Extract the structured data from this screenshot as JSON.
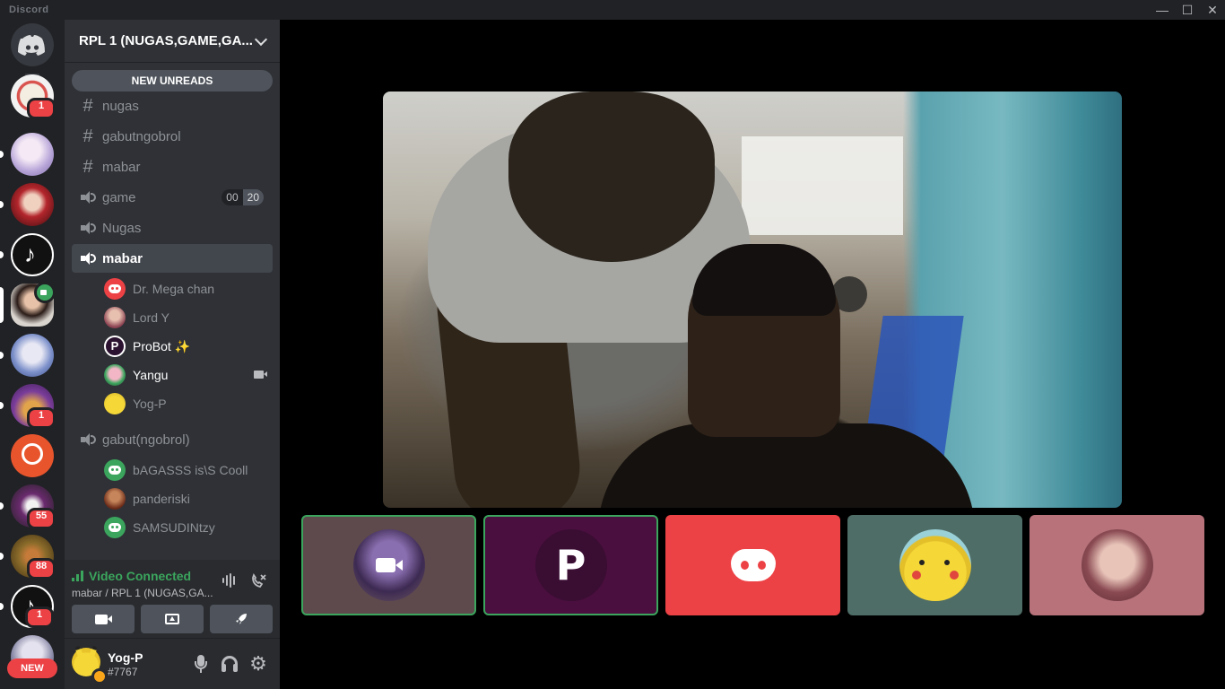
{
  "window": {
    "title": "Discord",
    "controls": [
      "minimize",
      "maximize",
      "close"
    ]
  },
  "guilds": {
    "home_icon": "discord-logo-icon",
    "items": [
      {
        "name": "server-1",
        "badge": "1",
        "color": "#d9534f"
      },
      {
        "name": "server-2",
        "badge": "",
        "color": "#b8a6d9"
      },
      {
        "name": "server-3",
        "badge": "",
        "color": "#b3262c"
      },
      {
        "name": "server-4",
        "badge": "",
        "color": "#111111"
      },
      {
        "name": "server-rpl1",
        "badge": "",
        "color": "#5a3a30",
        "active": true,
        "video": true
      },
      {
        "name": "server-6",
        "badge": "",
        "color": "#7b8fc9"
      },
      {
        "name": "server-7",
        "badge": "1",
        "color": "#7a3d9a"
      },
      {
        "name": "server-8",
        "badge": "",
        "color": "#e8552d"
      },
      {
        "name": "server-9",
        "badge": "55",
        "color": "#6a2a6e"
      },
      {
        "name": "server-10",
        "badge": "88",
        "color": "#8a6b2a"
      },
      {
        "name": "server-11",
        "badge": "1",
        "color": "#111111"
      },
      {
        "name": "server-12",
        "badge": "",
        "color": "#8a8aa8"
      }
    ],
    "new_label": "NEW"
  },
  "server": {
    "name": "RPL 1 (NUGAS,GAME,GA...",
    "new_unreads_label": "NEW UNREADS"
  },
  "channels": [
    {
      "type": "text",
      "name": "nugas"
    },
    {
      "type": "text",
      "name": "gabutngobrol"
    },
    {
      "type": "text",
      "name": "mabar"
    },
    {
      "type": "voice",
      "name": "game",
      "count_left": "00",
      "count_right": "20"
    },
    {
      "type": "voice",
      "name": "Nugas"
    },
    {
      "type": "voice",
      "name": "mabar",
      "active": true,
      "members": [
        {
          "name": "Dr. Mega chan",
          "avatar": "discord-red"
        },
        {
          "name": "Lord Y",
          "avatar": "pink"
        },
        {
          "name": "ProBot ✨",
          "avatar": "probot",
          "bright": true
        },
        {
          "name": "Yangu",
          "avatar": "yangu",
          "bright": true,
          "video": true
        },
        {
          "name": "Yog-P",
          "avatar": "pikachu"
        }
      ]
    },
    {
      "type": "voice",
      "name": "gabut(ngobrol)",
      "members": [
        {
          "name": "bAGASSS is\\S Cooll",
          "avatar": "discord-green"
        },
        {
          "name": "panderiski",
          "avatar": "panderiski"
        },
        {
          "name": "SAMSUDINtzy",
          "avatar": "discord-green"
        }
      ]
    }
  ],
  "voice_panel": {
    "status": "Video Connected",
    "location": "mabar / RPL 1 (NUGAS,GA...",
    "buttons": [
      "camera-icon",
      "screen-share-icon",
      "activity-rocket-icon"
    ]
  },
  "user_panel": {
    "username": "Yog-P",
    "tag": "#7767",
    "status_color": "#faa61a"
  },
  "tiles": [
    {
      "name": "tile-yangu-camera-off",
      "bg": "#5e4a4c",
      "speaking": true
    },
    {
      "name": "tile-probot",
      "bg": "#4a0f3e",
      "speaking": true
    },
    {
      "name": "tile-dr-mega-chan",
      "bg": "#ed4245",
      "speaking": false
    },
    {
      "name": "tile-yog-p",
      "bg": "#4e6d66",
      "speaking": false
    },
    {
      "name": "tile-lord-y",
      "bg": "#b7727a",
      "speaking": false
    }
  ]
}
